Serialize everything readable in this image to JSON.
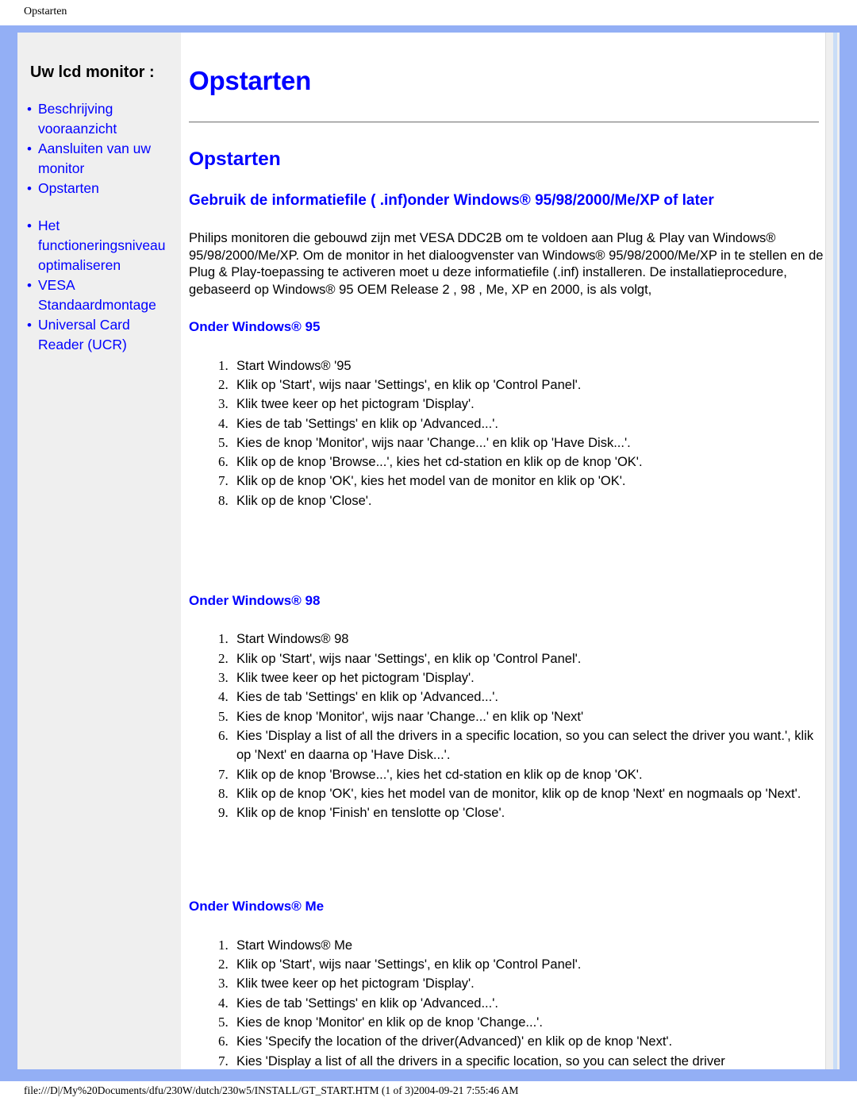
{
  "print_header": {
    "label": "Opstarten"
  },
  "print_footer": {
    "label": "file:///D|/My%20Documents/dfu/230W/dutch/230w5/INSTALL/GT_START.HTM (1 of 3)2004-09-21 7:55:46 AM"
  },
  "colors": {
    "page_border_blue": "#93AFF5",
    "sidebar_gray": "#EFEFEF",
    "link_blue": "#0000FF",
    "heading_blue": "#0000FF",
    "body_text": "#000000",
    "rule_gray": "#8A8A8A"
  },
  "sidebar": {
    "title": "Uw lcd monitor :",
    "bullet": "•",
    "items": [
      {
        "label": "Beschrijving vooraanzicht",
        "spaced": false
      },
      {
        "label": "Aansluiten van uw monitor",
        "spaced": false
      },
      {
        "label": "Opstarten",
        "spaced": false
      },
      {
        "label": "Het functioneringsniveau optimaliseren",
        "spaced": true
      },
      {
        "label": "VESA Standaardmontage",
        "spaced": false
      },
      {
        "label": "Universal Card Reader (UCR)",
        "spaced": false
      }
    ]
  },
  "main": {
    "doc_title": "Opstarten",
    "section_title": "Opstarten",
    "sub_title": "Gebruik de informatiefile ( .inf)onder Windows® 95/98/2000/Me/XP of later",
    "intro_paragraph": "Philips monitoren die gebouwd zijn met VESA DDC2B om te voldoen aan Plug & Play van Windows® 95/98/2000/Me/XP. Om de monitor in het dialoogvenster van Windows® 95/98/2000/Me/XP in te stellen en de Plug & Play-toepassing te activeren moet u deze informatiefile (.inf) installeren. De installatieprocedure, gebaseerd op Windows® 95 OEM Release 2 , 98 , Me, XP en 2000, is als volgt,",
    "sections": [
      {
        "heading": "Onder Windows® 95",
        "steps": [
          "Start Windows® '95",
          "Klik op 'Start', wijs naar 'Settings', en klik op 'Control Panel'.",
          "Klik twee keer op het pictogram 'Display'.",
          "Kies de tab 'Settings' en klik op 'Advanced...'.",
          "Kies de knop 'Monitor', wijs naar 'Change...' en klik op 'Have Disk...'.",
          "Klik op de knop 'Browse...', kies het cd-station en klik op de knop 'OK'.",
          "Klik op de knop 'OK', kies het model van de monitor en klik op 'OK'.",
          "Klik op de knop 'Close'."
        ]
      },
      {
        "heading": "Onder Windows® 98",
        "steps": [
          "Start Windows® 98",
          "Klik op 'Start', wijs naar 'Settings', en klik op 'Control Panel'.",
          "Klik twee keer op het pictogram 'Display'.",
          "Kies de tab 'Settings' en klik op 'Advanced...'.",
          "Kies de knop 'Monitor', wijs naar 'Change...' en klik op 'Next'",
          "Kies 'Display a list of  all the drivers in a specific location, so you  can select the driver you want.', klik op 'Next' en daarna op 'Have Disk...'.",
          "Klik op de knop 'Browse...', kies het cd-station en klik op de knop 'OK'.",
          "Klik op de knop 'OK', kies het model van de monitor, klik op de knop 'Next' en nogmaals op 'Next'.",
          "Klik op de knop 'Finish' en tenslotte op 'Close'."
        ]
      },
      {
        "heading": "Onder Windows® Me",
        "steps": [
          "Start Windows® Me",
          "Klik op 'Start', wijs naar 'Settings', en klik op 'Control Panel'.",
          "Klik twee keer op het pictogram 'Display'.",
          "Kies de tab 'Settings' en klik op 'Advanced...'.",
          "Kies de knop 'Monitor' en klik op de knop 'Change...'.",
          "Kies 'Specify the location of the driver(Advanced)' en klik op de knop 'Next'.",
          "Kies 'Display a list of  all the drivers in a specific location, so you  can select the driver"
        ]
      }
    ]
  }
}
